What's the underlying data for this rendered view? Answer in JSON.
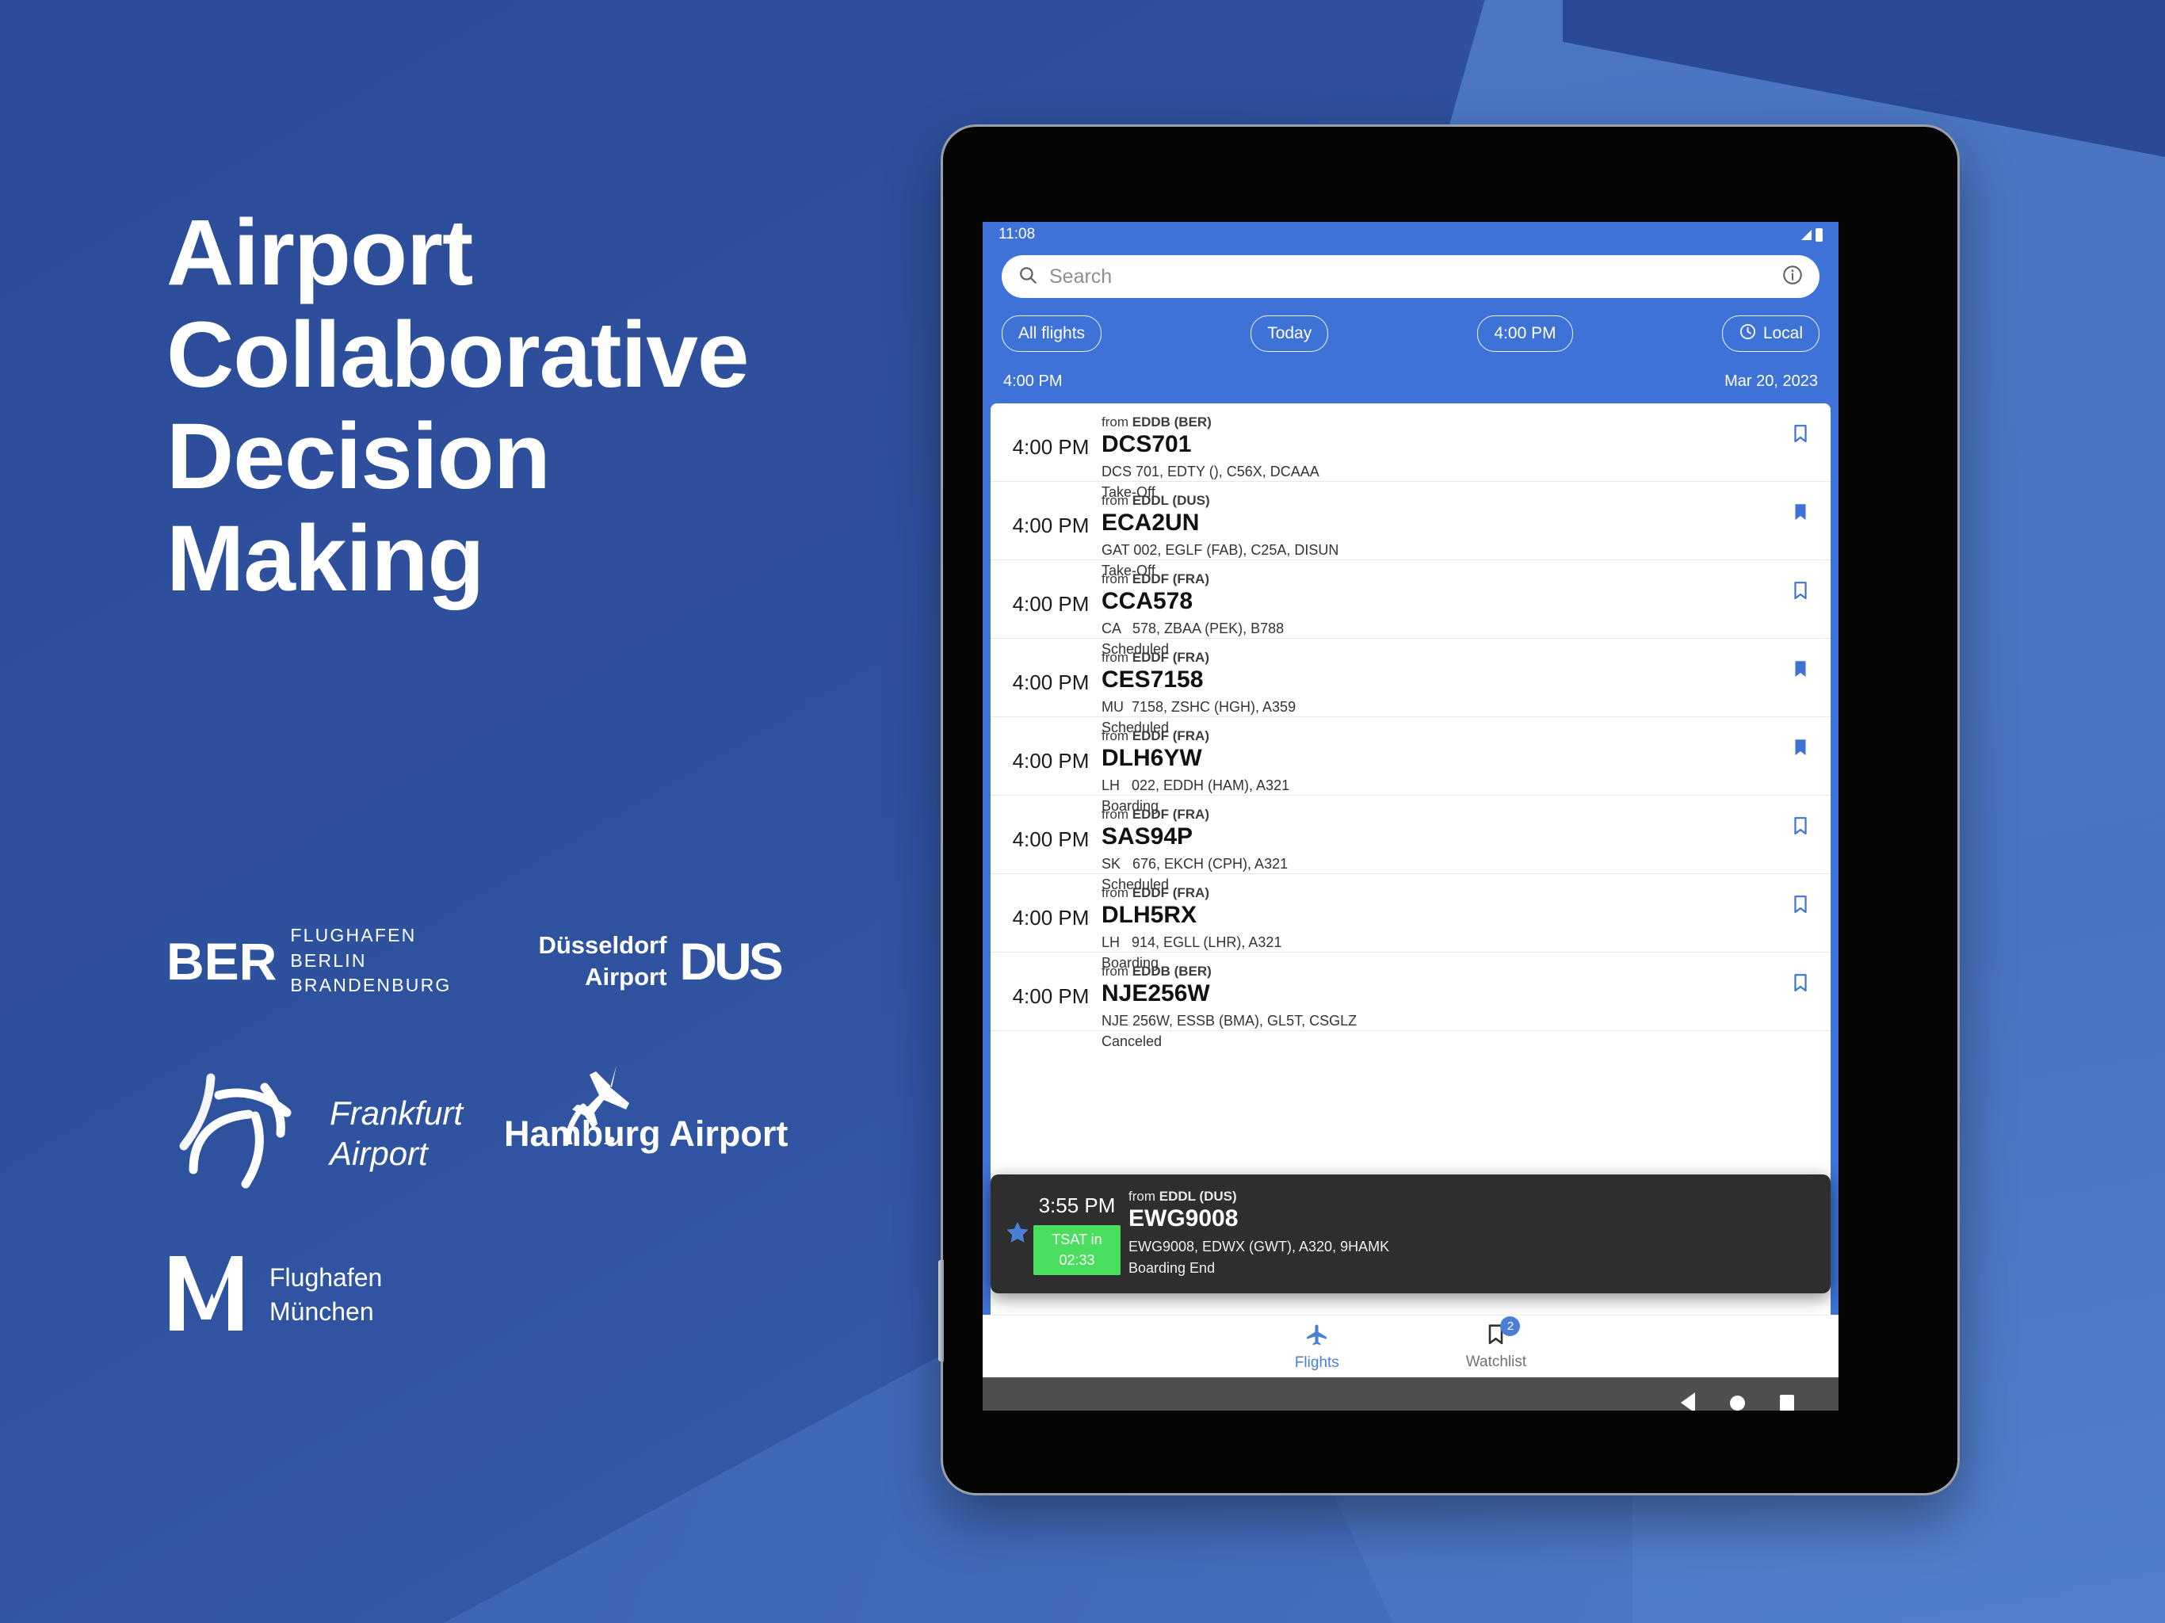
{
  "marketing": {
    "headline": "Airport\nCollaborative\nDecision\nMaking",
    "logos": [
      {
        "mark": "BER",
        "sub": "FLUGHAFEN\nBERLIN\nBRANDENBURG",
        "name": "ber-logo"
      },
      {
        "words": "Düsseldorf\nAirport",
        "mark": "DUS",
        "name": "dus-logo"
      },
      {
        "words": "Frankfurt\nAirport",
        "name": "frankfurt-airport-logo"
      },
      {
        "words": "Hamburg Airport",
        "name": "hamburg-airport-logo"
      },
      {
        "mark": "M",
        "words": "Flughafen\nMünchen",
        "name": "munich-airport-logo"
      }
    ]
  },
  "device": {
    "status_bar": {
      "time": "11:08",
      "signal_icon": "signal-triangle-icon",
      "battery_icon": "battery-icon"
    }
  },
  "app": {
    "search": {
      "placeholder": "Search",
      "value": "",
      "search_icon": "search-icon",
      "info_icon": "info-circle-icon"
    },
    "filters": [
      {
        "label": "All flights",
        "icon": null
      },
      {
        "label": "Today",
        "icon": null
      },
      {
        "label": "4:00 PM",
        "icon": null
      },
      {
        "label": "Local",
        "icon": "clock-icon"
      }
    ],
    "subheader": {
      "time": "4:00 PM",
      "date": "Mar 20, 2023"
    },
    "accent_color": "#3F72D7",
    "flights": [
      {
        "time": "4:00 PM",
        "from_label": "from",
        "from": "EDDB (BER)",
        "code": "DCS701",
        "detail": "DCS 701, EDTY (), C56X, DCAAA",
        "status": "Take-Off",
        "bookmarked": false
      },
      {
        "time": "4:00 PM",
        "from_label": "from",
        "from": "EDDL (DUS)",
        "code": "ECA2UN",
        "detail": "GAT 002, EGLF (FAB), C25A, DISUN",
        "status": "Take-Off",
        "bookmarked": true
      },
      {
        "time": "4:00 PM",
        "from_label": "from",
        "from": "EDDF (FRA)",
        "code": "CCA578",
        "detail": "CA   578, ZBAA (PEK), B788",
        "status": "Scheduled",
        "bookmarked": false
      },
      {
        "time": "4:00 PM",
        "from_label": "from",
        "from": "EDDF (FRA)",
        "code": "CES7158",
        "detail": "MU  7158, ZSHC (HGH), A359",
        "status": "Scheduled",
        "bookmarked": true
      },
      {
        "time": "4:00 PM",
        "from_label": "from",
        "from": "EDDF (FRA)",
        "code": "DLH6YW",
        "detail": "LH   022, EDDH (HAM), A321",
        "status": "Boarding",
        "bookmarked": true
      },
      {
        "time": "4:00 PM",
        "from_label": "from",
        "from": "EDDF (FRA)",
        "code": "SAS94P",
        "detail": "SK   676, EKCH (CPH), A321",
        "status": "Scheduled",
        "bookmarked": false
      },
      {
        "time": "4:00 PM",
        "from_label": "from",
        "from": "EDDF (FRA)",
        "code": "DLH5RX",
        "detail": "LH   914, EGLL (LHR), A321",
        "status": "Boarding",
        "bookmarked": false
      },
      {
        "time": "4:00 PM",
        "from_label": "from",
        "from": "EDDB (BER)",
        "code": "NJE256W",
        "detail": "NJE 256W, ESSB (BMA), GL5T, CSGLZ",
        "status": "Canceled",
        "bookmarked": false
      }
    ],
    "overlay": {
      "star_icon": "star-icon",
      "time": "3:55 PM",
      "tsat_label": "TSAT in",
      "tsat_value": "02:33",
      "tsat_color": "#4ade5f",
      "from_label": "from",
      "from": "EDDL (DUS)",
      "code": "EWG9008",
      "detail": "EWG9008, EDWX (GWT), A320, 9HAMK",
      "status": "Boarding End"
    },
    "bottom_nav": [
      {
        "label": "Flights",
        "icon": "airplane-icon",
        "active": true,
        "badge": null
      },
      {
        "label": "Watchlist",
        "icon": "bookmark-icon",
        "active": false,
        "badge": "2"
      }
    ]
  },
  "system_nav": {
    "back_icon": "back-triangle-icon",
    "home_icon": "home-circle-icon",
    "recents_icon": "recents-square-icon"
  }
}
